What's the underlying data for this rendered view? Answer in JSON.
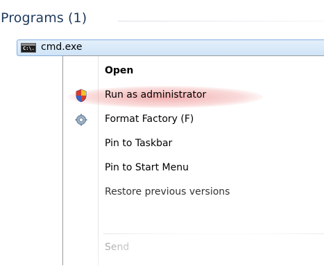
{
  "section": {
    "title": "Programs (1)"
  },
  "result": {
    "label": "cmd.exe",
    "icon": "cmd-console-icon",
    "icon_text": "C:\\."
  },
  "context_menu": {
    "items": [
      {
        "label": "Open",
        "style": "bold"
      },
      {
        "label": "Run as administrator",
        "icon": "uac-shield-icon",
        "highlighted": true
      },
      {
        "label": "Format Factory (F)",
        "icon": "format-factory-icon"
      },
      {
        "label": "Pin to Taskbar"
      },
      {
        "label": "Pin to Start Menu"
      },
      {
        "label": "Restore previous versions",
        "style": "partially-obscured"
      },
      {
        "label": "Send",
        "style": "partially-obscured"
      }
    ]
  },
  "colors": {
    "title_text": "#1e395b",
    "selection_border": "#84acdd",
    "selection_fill": "#d9e9f8",
    "highlight": "#e87d7d"
  }
}
